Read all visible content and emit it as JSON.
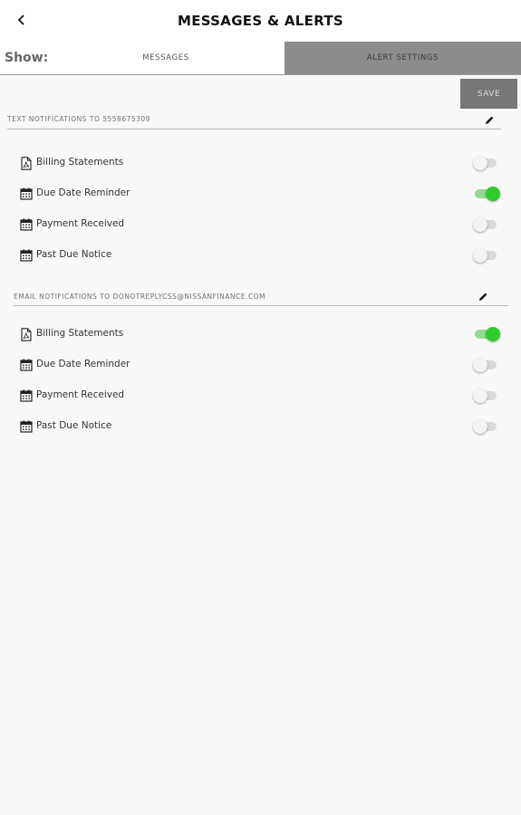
{
  "header": {
    "title": "MESSAGES & ALERTS",
    "back_icon": "chevron-left-icon"
  },
  "tabs": {
    "show_label": "Show:",
    "messages_label": "MESSAGES",
    "alert_settings_label": "ALERT SETTINGS",
    "selected": "ALERT SETTINGS"
  },
  "save_label": "SAVE",
  "colors": {
    "toggle_on": "#2ecc2e",
    "selected_tab": "#8c8c8c",
    "save_button": "#777777"
  },
  "text_section": {
    "title": "TEXT NOTIFICATIONS TO 5558675309",
    "edit_icon": "pencil-icon",
    "items": [
      {
        "label": "Billing Statements",
        "icon": "pdf-document-icon",
        "enabled": false
      },
      {
        "label": "Due Date Reminder",
        "icon": "calendar-icon",
        "enabled": true
      },
      {
        "label": "Payment Received",
        "icon": "calendar-icon",
        "enabled": false
      },
      {
        "label": "Past Due Notice",
        "icon": "calendar-icon",
        "enabled": false
      }
    ]
  },
  "email_section": {
    "title": "EMAIL NOTIFICATIONS TO DONOTREPLYCSS@NISSANFINANCE.COM",
    "edit_icon": "pencil-icon",
    "items": [
      {
        "label": "Billing Statements",
        "icon": "pdf-document-icon",
        "enabled": true
      },
      {
        "label": "Due Date Reminder",
        "icon": "calendar-icon",
        "enabled": false
      },
      {
        "label": "Payment Received",
        "icon": "calendar-icon",
        "enabled": false
      },
      {
        "label": "Past Due Notice",
        "icon": "calendar-icon",
        "enabled": false
      }
    ]
  }
}
